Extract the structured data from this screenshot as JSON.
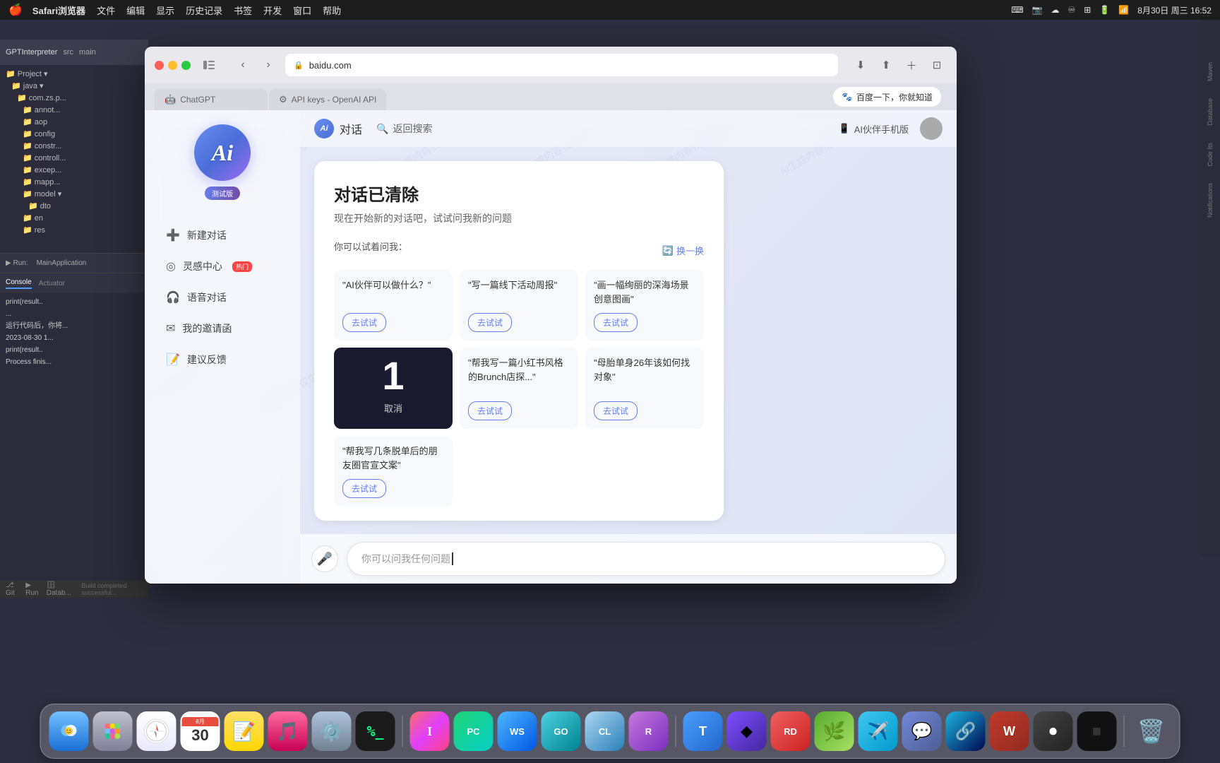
{
  "menubar": {
    "apple": "🍎",
    "items": [
      "Safari浏览器",
      "文件",
      "编辑",
      "显示",
      "历史记录",
      "书签",
      "开发",
      "窗口",
      "帮助"
    ],
    "time": "8月30日 周三 16:52",
    "icons": [
      "⌨",
      "📷",
      "☁",
      "♾",
      "🔲"
    ]
  },
  "ide": {
    "title": "GPTInterpreter",
    "tabs": [
      "src",
      "main"
    ],
    "project_label": "Project",
    "tree": [
      {
        "label": "Project",
        "indent": 0,
        "icon": "📁"
      },
      {
        "label": "java",
        "indent": 1,
        "icon": "📁"
      },
      {
        "label": "com.zs.p...",
        "indent": 2,
        "icon": "📁"
      },
      {
        "label": "annot...",
        "indent": 3,
        "icon": "📁"
      },
      {
        "label": "aop",
        "indent": 3,
        "icon": "📁"
      },
      {
        "label": "config",
        "indent": 3,
        "icon": "📁"
      },
      {
        "label": "constr...",
        "indent": 3,
        "icon": "📁"
      },
      {
        "label": "controll...",
        "indent": 3,
        "icon": "📁"
      },
      {
        "label": "excep...",
        "indent": 3,
        "icon": "📁"
      },
      {
        "label": "mapp...",
        "indent": 3,
        "icon": "📁"
      },
      {
        "label": "model",
        "indent": 3,
        "icon": "📁"
      },
      {
        "label": "dto",
        "indent": 4,
        "icon": "📁"
      },
      {
        "label": "en",
        "indent": 3,
        "icon": "📁"
      },
      {
        "label": "res",
        "indent": 3,
        "icon": "📁"
      }
    ],
    "bottom_tabs": [
      "Console",
      "Actuator"
    ],
    "run_label": "Run:",
    "main_app": "MainApplication",
    "console_lines": [
      "print(result..",
      "...",
      "运行代码后，你将...",
      "2023-08-30 1...",
      "print(result..",
      "",
      "Process finis..."
    ],
    "status": "Build completed successful..."
  },
  "browser": {
    "url": "baidu.com",
    "tabs": [
      {
        "label": "ChatGPT",
        "icon": "🤖",
        "active": false
      },
      {
        "label": "API keys - OpenAI API",
        "icon": "⚙",
        "active": false
      }
    ],
    "baidu_btn": "百度一下，你就知道"
  },
  "ai_chat": {
    "header_title": "对话",
    "header_search": "返回搜索",
    "mobile_label": "AI伙伴手机版",
    "logo_text": "Ai",
    "badge_text": "测试版",
    "sidebar_menu": [
      {
        "icon": "➕",
        "label": "新建对话"
      },
      {
        "icon": "💡",
        "label": "灵感中心",
        "hot": true
      },
      {
        "icon": "🎧",
        "label": "语音对话"
      },
      {
        "icon": "✉",
        "label": "我的邀请函"
      },
      {
        "icon": "📝",
        "label": "建议反馈"
      }
    ],
    "cleared_title": "对话已清除",
    "cleared_subtitle": "现在开始新的对话吧，试试问我新的问题",
    "try_label": "你可以试着问我：",
    "refresh_label": "换一换",
    "suggestions": [
      {
        "text": "\"AI伙伴可以做什么？\"",
        "try_btn": "去试试",
        "featured": false
      },
      {
        "text": "\"写一篇线下活动周报\"",
        "try_btn": "去试试",
        "featured": false
      },
      {
        "text": "\"画一幅绚丽的深海场景创意图画\"",
        "try_btn": "去试试",
        "featured": false
      },
      {
        "text": "1",
        "featured": true,
        "cancel_label": "取消"
      },
      {
        "text": "\"帮我写一篇小红书风格的Brunch店探...\"",
        "try_btn": "去试试",
        "featured": false
      },
      {
        "text": "\"帮我写几条脱单后的朋友圈官宣文案\"",
        "try_btn": "去试试",
        "featured": false
      },
      {
        "text": "\"母胎单身26年该如何找对象\"",
        "try_btn": "去试试",
        "featured": false
      }
    ],
    "input_placeholder": "你可以问我任何问题"
  },
  "dock": {
    "icons": [
      {
        "name": "finder",
        "emoji": "🔵",
        "class": "di-finder"
      },
      {
        "name": "launchpad",
        "emoji": "⬛",
        "class": "di-launchpad"
      },
      {
        "name": "safari",
        "emoji": "🧭",
        "class": "di-safari"
      },
      {
        "name": "calendar",
        "emoji": "📅",
        "class": "di-calendar",
        "label": "8月\n30"
      },
      {
        "name": "notes",
        "emoji": "📝",
        "class": "di-notes"
      },
      {
        "name": "music",
        "emoji": "🎵",
        "class": "di-music"
      },
      {
        "name": "syspref",
        "emoji": "⚙",
        "class": "di-syspref"
      },
      {
        "name": "terminal",
        "emoji": "⬛",
        "class": "di-terminal"
      },
      {
        "name": "intellij",
        "emoji": "I",
        "class": "di-intellij"
      },
      {
        "name": "pycharm",
        "emoji": "PC",
        "class": "di-pycharm"
      },
      {
        "name": "webstorm",
        "emoji": "WS",
        "class": "di-webstorm"
      },
      {
        "name": "goland",
        "emoji": "GO",
        "class": "di-goland"
      },
      {
        "name": "clion",
        "emoji": "CL",
        "class": "di-clion"
      },
      {
        "name": "rider",
        "emoji": "R",
        "class": "di-rider"
      },
      {
        "name": "typora",
        "emoji": "T",
        "class": "di-typora"
      },
      {
        "name": "obsidian",
        "emoji": "◆",
        "class": "di-obsidian"
      },
      {
        "name": "rdp",
        "emoji": "RD",
        "class": "di-rdp"
      },
      {
        "name": "telegram",
        "emoji": "✈",
        "class": "di-telegram"
      },
      {
        "name": "discord",
        "emoji": "🎮",
        "class": "di-discord"
      },
      {
        "name": "focus",
        "emoji": "◎",
        "class": "di-focus"
      },
      {
        "name": "wps",
        "emoji": "W",
        "class": "di-wps"
      },
      {
        "name": "kap",
        "emoji": "●",
        "class": "di-kap"
      },
      {
        "name": "black",
        "emoji": "■",
        "class": "di-black"
      },
      {
        "name": "trash",
        "emoji": "🗑",
        "class": "di-trash"
      }
    ]
  }
}
